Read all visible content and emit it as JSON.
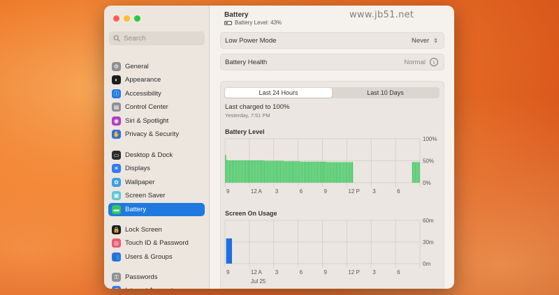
{
  "window": {
    "sidebar": {
      "search_placeholder": "Search",
      "items": [
        {
          "label": "General",
          "icon": "gear-icon",
          "color": "#8e8e93"
        },
        {
          "label": "Appearance",
          "icon": "appearance-icon",
          "color": "#1c1c1e"
        },
        {
          "label": "Accessibility",
          "icon": "accessibility-icon",
          "color": "#1f7ae0"
        },
        {
          "label": "Control Center",
          "icon": "control-center-icon",
          "color": "#8e8e93"
        },
        {
          "label": "Siri & Spotlight",
          "icon": "siri-icon",
          "color": "#b23ec4"
        },
        {
          "label": "Privacy & Security",
          "icon": "hand-icon",
          "color": "#2f6fe0"
        },
        {
          "label": "Desktop & Dock",
          "icon": "dock-icon",
          "color": "#2c2c2e"
        },
        {
          "label": "Displays",
          "icon": "displays-icon",
          "color": "#2f7cf0"
        },
        {
          "label": "Wallpaper",
          "icon": "wallpaper-icon",
          "color": "#3aa0e8"
        },
        {
          "label": "Screen Saver",
          "icon": "screen-saver-icon",
          "color": "#5ac8d8"
        },
        {
          "label": "Battery",
          "icon": "battery-icon",
          "color": "#34c759"
        },
        {
          "label": "Lock Screen",
          "icon": "lock-icon",
          "color": "#1c1c1e"
        },
        {
          "label": "Touch ID & Password",
          "icon": "fingerprint-icon",
          "color": "#ea5b73"
        },
        {
          "label": "Users & Groups",
          "icon": "users-icon",
          "color": "#2f6fe0"
        },
        {
          "label": "Passwords",
          "icon": "key-icon",
          "color": "#8e8e93"
        },
        {
          "label": "Internet Accounts",
          "icon": "at-icon",
          "color": "#2f7cf0"
        }
      ],
      "active_index": 10
    },
    "main": {
      "title": "Battery",
      "subtitle": "Battery Level: 43%",
      "watermark": "www.jb51.net",
      "low_power": {
        "label": "Low Power Mode",
        "value": "Never"
      },
      "health": {
        "label": "Battery Health",
        "value": "Normal"
      },
      "tabs": [
        "Last 24 Hours",
        "Last 10 Days"
      ],
      "selected_tab": 0,
      "charged": "Last charged to 100%",
      "charged_time": "Yesterday, 7:51 PM"
    }
  },
  "chart_data": [
    {
      "type": "bar",
      "title": "Battery Level",
      "x_tick_labels": [
        "9",
        "12 A",
        "3",
        "6",
        "9",
        "12 P",
        "3",
        "6"
      ],
      "y_tick_labels": [
        "100%",
        "50%",
        "0%"
      ],
      "ylim": [
        0,
        100
      ],
      "color": "#34c759",
      "values": [
        63,
        52,
        51,
        51,
        51,
        51,
        51,
        51,
        51,
        51,
        51,
        51,
        51,
        51,
        51,
        51,
        51,
        51,
        51,
        51,
        51,
        51,
        51,
        51,
        51,
        51,
        51,
        51,
        51,
        50,
        50,
        50,
        50,
        50,
        50,
        50,
        50,
        50,
        50,
        50,
        50,
        50,
        50,
        50,
        49,
        49,
        49,
        49,
        49,
        49,
        49,
        49,
        49,
        49,
        49,
        49,
        48,
        48,
        48,
        48,
        48,
        48,
        48,
        48,
        48,
        48,
        48,
        48,
        48,
        48,
        48,
        48,
        48,
        48,
        48,
        48,
        47,
        47,
        47,
        47,
        47,
        47,
        47,
        47,
        47,
        47,
        47,
        47,
        47,
        47,
        47,
        47,
        47,
        47,
        47,
        47,
        0,
        0,
        0,
        0,
        0,
        0,
        0,
        0,
        0,
        0,
        0,
        0,
        0,
        0,
        0,
        0,
        0,
        0,
        0,
        0,
        0,
        0,
        0,
        0,
        0,
        0,
        0,
        0,
        0,
        0,
        0,
        0,
        0,
        0,
        0,
        0,
        0,
        0,
        0,
        0,
        0,
        0,
        0,
        0,
        47,
        47,
        47,
        47,
        47,
        47
      ]
    },
    {
      "type": "bar",
      "title": "Screen On Usage",
      "x_tick_labels": [
        "9",
        "12 A",
        "3",
        "6",
        "9",
        "12 P",
        "3",
        "6"
      ],
      "y_tick_labels": [
        "60m",
        "30m",
        "0m"
      ],
      "date_label": "Jul 25",
      "ylim": [
        0,
        60
      ],
      "color": "#1f6fe0",
      "values": [
        35,
        0,
        0,
        0,
        0,
        0,
        0,
        0,
        0,
        0,
        0,
        0,
        0,
        0,
        0,
        0,
        0,
        0,
        0,
        0,
        0,
        0,
        0,
        0
      ]
    }
  ]
}
